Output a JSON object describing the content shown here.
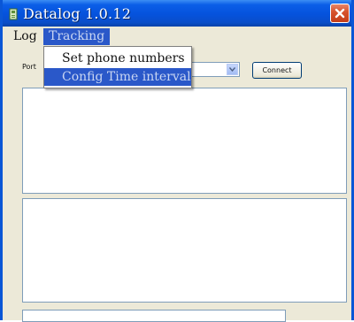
{
  "window": {
    "title": "Datalog 1.0.12",
    "accent_color": "#0552dc",
    "close_color": "#d7542f"
  },
  "menubar": {
    "items": [
      {
        "label": "Log"
      },
      {
        "label": "Tracking",
        "state": "open"
      }
    ]
  },
  "tracking_menu": {
    "items": [
      {
        "label": "Set phone numbers"
      },
      {
        "label": "Config Time interval",
        "state": "highlighted"
      }
    ]
  },
  "connection": {
    "port_label": "Port",
    "port_value": "",
    "connect_label": "Connect"
  },
  "icons": [
    "app-icon",
    "close-icon",
    "chevron-down-icon"
  ]
}
